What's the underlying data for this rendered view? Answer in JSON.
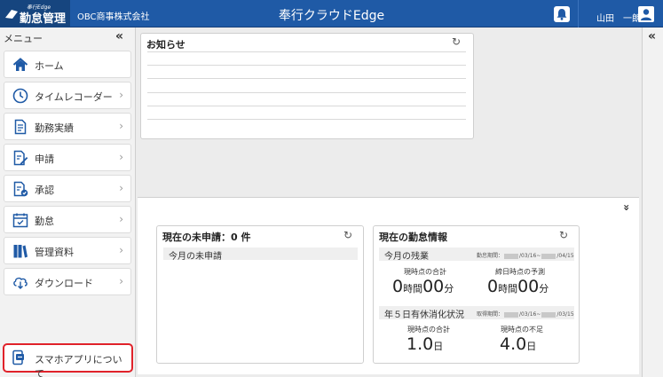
{
  "header": {
    "logo_small": "奉行Edge",
    "logo_main": "勤怠管理",
    "company": "OBC商事株式会社",
    "app_title": "奉行クラウドEdge",
    "user_name": "山田　一朗"
  },
  "sidebar": {
    "menu_label": "メニュー",
    "collapse_glyph": "«",
    "items": [
      {
        "label": "ホーム",
        "icon": "home-icon",
        "chevron": ""
      },
      {
        "label": "タイムレコーダー",
        "icon": "clock-icon",
        "chevron": "›"
      },
      {
        "label": "勤務実績",
        "icon": "document-icon",
        "chevron": "›"
      },
      {
        "label": "申請",
        "icon": "edit-document-icon",
        "chevron": "›"
      },
      {
        "label": "承認",
        "icon": "approve-icon",
        "chevron": "›"
      },
      {
        "label": "勤怠",
        "icon": "calendar-icon",
        "chevron": "›"
      },
      {
        "label": "管理資料",
        "icon": "books-icon",
        "chevron": "›"
      },
      {
        "label": "ダウンロード",
        "icon": "cloud-download-icon",
        "chevron": "›"
      }
    ],
    "app_button": {
      "label": "スマホアプリについて",
      "icon": "smartphone-app-icon"
    }
  },
  "right_rail": {
    "collapse_glyph": "«"
  },
  "notices": {
    "title": "お知らせ",
    "refresh_glyph": "↻"
  },
  "expand_glyph": "»",
  "pending": {
    "title": "現在の未申請：0 件",
    "refresh_glyph": "↻",
    "row": "今月の未申請"
  },
  "attendance": {
    "title": "現在の勤怠情報",
    "refresh_glyph": "↻",
    "overtime": {
      "label": "今月の残業",
      "period_prefix": "勤怠期間：",
      "period_start": "/03/16~",
      "period_end": "/04/15",
      "current_label": "現時点の合計",
      "current_h": "0",
      "current_m": "00",
      "forecast_label": "締日時点の予測",
      "forecast_h": "0",
      "forecast_m": "00",
      "unit_h": "時間",
      "unit_m": "分"
    },
    "leave": {
      "label": "年５日有休消化状況",
      "period_prefix": "取得期間：",
      "period_start": "/03/16~",
      "period_end": "/03/15",
      "current_label": "現時点の合計",
      "current_value": "1.0",
      "shortage_label": "現時点の不足",
      "shortage_value": "4.0",
      "unit": "日"
    }
  },
  "colors": {
    "header_bg": "#1f5aa6",
    "highlight_border": "#e0222a",
    "icon_blue": "#1f5aa6"
  }
}
